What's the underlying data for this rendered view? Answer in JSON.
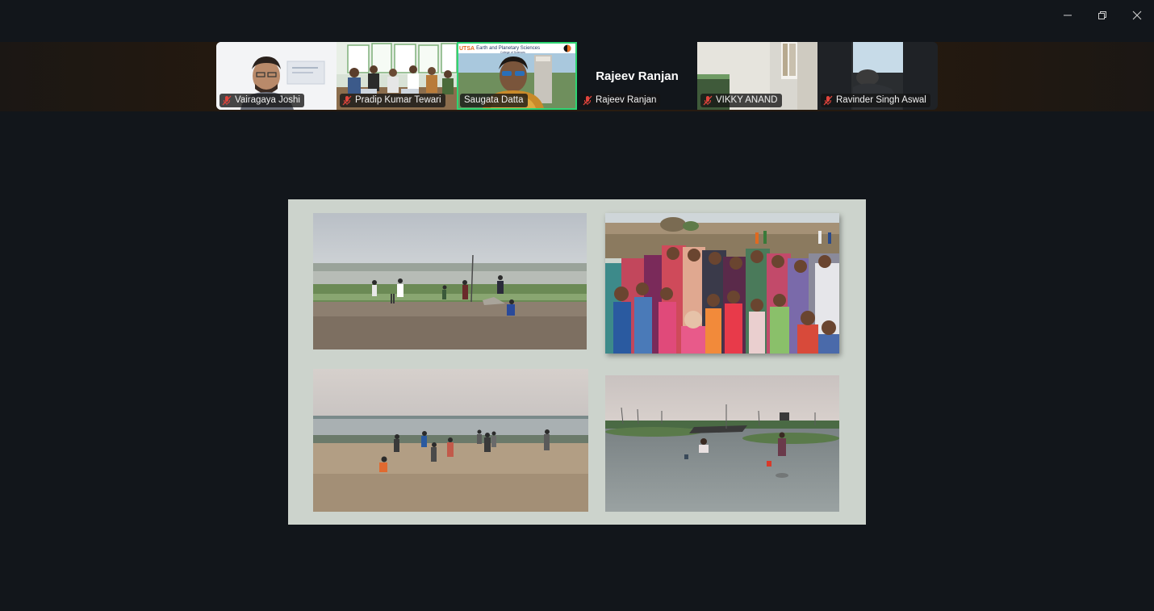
{
  "participants": [
    {
      "name": "Vairagaya Joshi",
      "muted": true
    },
    {
      "name": "Pradip Kumar Tewari",
      "muted": true
    },
    {
      "name": "Saugata Datta",
      "muted": false,
      "speaking": true,
      "background_text": {
        "brand": "UTSA",
        "department": "Earth and Planetary Sciences",
        "college": "College of Sciences"
      }
    },
    {
      "name": "Rajeev Ranjan",
      "display_title": "Rajeev Ranjan",
      "muted": true,
      "video_off": true
    },
    {
      "name": "VIKKY ANAND",
      "muted": true
    },
    {
      "name": "Ravinder Singh Aswal",
      "muted": true
    }
  ],
  "slide": {
    "photos": [
      {
        "name": "cricket-on-riverbank-photo"
      },
      {
        "name": "village-women-and-children-photo"
      },
      {
        "name": "children-on-beach-photo"
      },
      {
        "name": "wading-in-shallow-water-photo"
      }
    ]
  },
  "colors": {
    "background": "#12161b",
    "active_speaker": "#2ed573",
    "muted_icon": "#e0443c",
    "slide_background": "#ccd3cc"
  },
  "icons": {
    "minimize": "minimize-icon",
    "restore": "restore-icon",
    "close": "close-icon",
    "muted": "microphone-muted-icon"
  }
}
